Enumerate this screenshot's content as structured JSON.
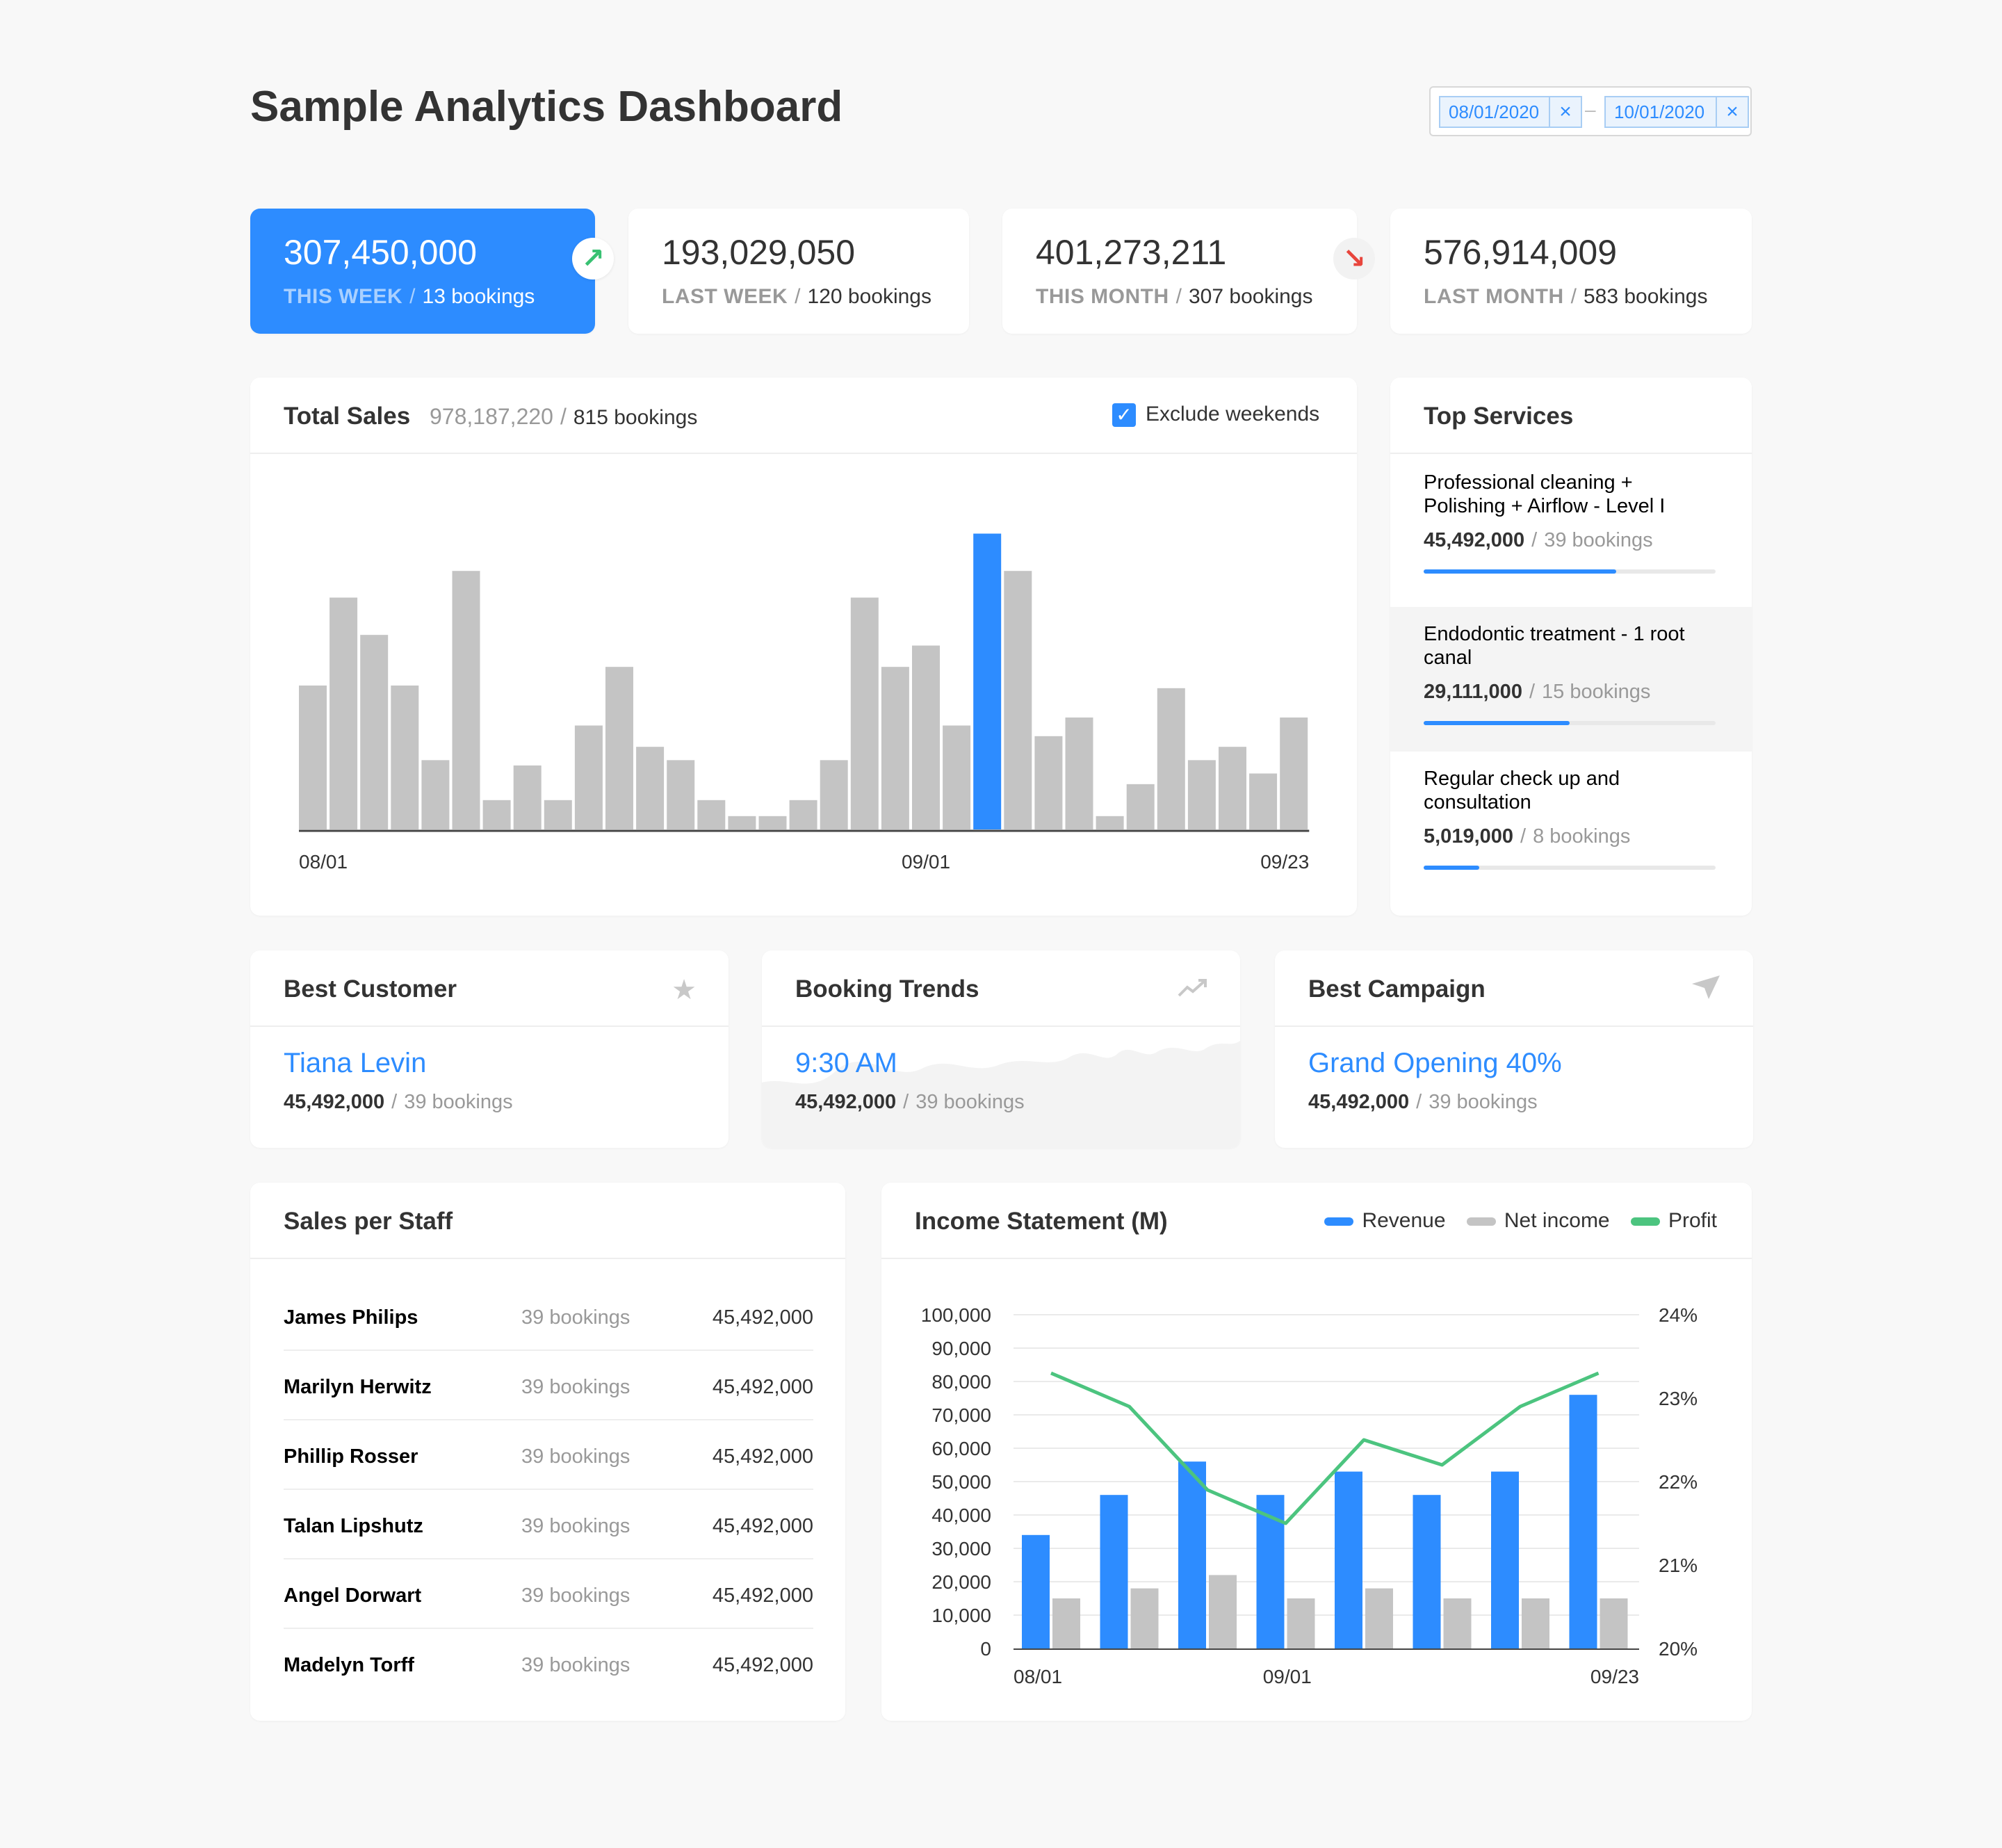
{
  "page_title": "Sample Analytics Dashboard",
  "date_range": {
    "start": "08/01/2020",
    "end": "10/01/2020",
    "clear_icon": "×",
    "separator": "–"
  },
  "colors": {
    "accent": "#2d8cff",
    "bar_gray": "#c4c4c4",
    "profit": "#4cc47f",
    "up": "#38c172",
    "down": "#e8453c"
  },
  "kpis": [
    {
      "value": "307,450,000",
      "period": "THIS WEEK",
      "bookings": "13 bookings",
      "trend": "up",
      "trend_icon": "↗"
    },
    {
      "value": "193,029,050",
      "period": "LAST WEEK",
      "bookings": "120 bookings"
    },
    {
      "value": "401,273,211",
      "period": "THIS MONTH",
      "bookings": "307 bookings",
      "trend": "down",
      "trend_icon": "↘"
    },
    {
      "value": "576,914,009",
      "period": "LAST MONTH",
      "bookings": "583 bookings"
    }
  ],
  "total_sales": {
    "title": "Total Sales",
    "amount": "978,187,220",
    "bookings": "815 bookings",
    "exclude_label": "Exclude weekends",
    "exclude_checked": true,
    "check_icon": "✓"
  },
  "chart_data": [
    {
      "type": "bar",
      "values": [
        54,
        87,
        73,
        54,
        26,
        97,
        11,
        24,
        11,
        39,
        61,
        31,
        26,
        11,
        5,
        5,
        11,
        26,
        87,
        61,
        69,
        39,
        111,
        97,
        35,
        42,
        5,
        17,
        53,
        26,
        31,
        21,
        42
      ],
      "highlight_index": 22,
      "tick_labels": [
        "08/01",
        "09/01",
        "09/23"
      ],
      "ylim": [
        0,
        120
      ]
    },
    {
      "type": "bar",
      "categories": [
        "08/01",
        "",
        "",
        "",
        "09/01",
        "",
        "",
        "09/23"
      ],
      "series": [
        {
          "name": "Revenue",
          "values": [
            34000,
            46000,
            56000,
            46000,
            53000,
            46000,
            53000,
            76000
          ]
        },
        {
          "name": "Net income",
          "values": [
            15000,
            18000,
            22000,
            15000,
            18000,
            15000,
            15000,
            15000
          ]
        },
        {
          "name": "Profit",
          "type": "line",
          "axis": "right",
          "values": [
            23.3,
            22.9,
            21.9,
            21.5,
            22.5,
            22.2,
            22.9,
            23.3
          ]
        }
      ],
      "ylim": [
        0,
        100000
      ],
      "y2lim": [
        20,
        24
      ],
      "y_ticks": [
        "0",
        "10,000",
        "20,000",
        "30,000",
        "40,000",
        "50,000",
        "60,000",
        "70,000",
        "80,000",
        "90,000",
        "100,000"
      ],
      "y2_ticks": [
        "20%",
        "21%",
        "22%",
        "23%",
        "24%"
      ],
      "x_ticks": [
        "08/01",
        "09/01",
        "09/23"
      ]
    }
  ],
  "top_services": {
    "title": "Top Services",
    "items": [
      {
        "name": "Professional cleaning + Polishing + Airflow - Level I",
        "amount": "45,492,000",
        "bookings": "39 bookings",
        "progress": 0.66
      },
      {
        "name": "Endodontic treatment - 1 root canal",
        "amount": "29,111,000",
        "bookings": "15 bookings",
        "progress": 0.5
      },
      {
        "name": "Regular check up and consultation",
        "amount": "5,019,000",
        "bookings": "8 bookings",
        "progress": 0.19
      }
    ]
  },
  "best_customer": {
    "title": "Best Customer",
    "icon": "star-icon",
    "name": "Tiana Levin",
    "amount": "45,492,000",
    "bookings": "39 bookings"
  },
  "booking_trends": {
    "title": "Booking Trends",
    "icon": "trending-up-icon",
    "time": "9:30 AM",
    "amount": "45,492,000",
    "bookings": "39 bookings"
  },
  "best_campaign": {
    "title": "Best Campaign",
    "icon": "send-icon",
    "name": "Grand Opening 40%",
    "amount": "45,492,000",
    "bookings": "39 bookings"
  },
  "sales_per_staff": {
    "title": "Sales per Staff",
    "rows": [
      {
        "name": "James Philips",
        "bookings": "39 bookings",
        "amount": "45,492,000"
      },
      {
        "name": "Marilyn Herwitz",
        "bookings": "39 bookings",
        "amount": "45,492,000"
      },
      {
        "name": "Phillip Rosser",
        "bookings": "39 bookings",
        "amount": "45,492,000"
      },
      {
        "name": "Talan Lipshutz",
        "bookings": "39 bookings",
        "amount": "45,492,000"
      },
      {
        "name": "Angel Dorwart",
        "bookings": "39 bookings",
        "amount": "45,492,000"
      },
      {
        "name": "Madelyn Torff",
        "bookings": "39 bookings",
        "amount": "45,492,000"
      }
    ]
  },
  "income_statement": {
    "title": "Income Statement (M)",
    "legend": [
      "Revenue",
      "Net income",
      "Profit"
    ]
  }
}
